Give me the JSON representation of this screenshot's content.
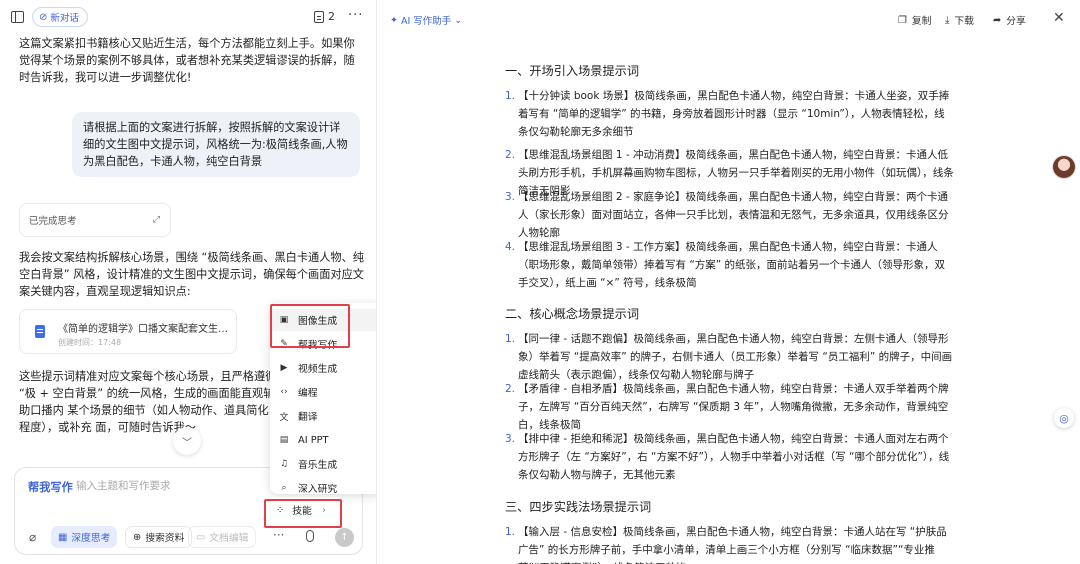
{
  "left_panel": {
    "new_chat_label": "新对话",
    "doc_count": "2",
    "messages": {
      "intro": "这篇文案紧扣书籍核心又贴近生活，每个方法都能立刻上手。如果你觉得某个场景的案例不够具体，或者想补充某类逻辑谬误的拆解，随时告诉我，我可以进一步调整优化!",
      "user_request": "请根据上面的文案进行拆解，按照拆解的文案设计详细的文生图中文提示词，风格统一为:极简线条画,人物为黑白配色，卡通人物，纯空白背景",
      "thinking_label": "已完成思考",
      "reply": "我会按文案结构拆解核心场景，围绕 “极简线条画、黑白卡通人物、纯空白背景” 风格，设计精准的文生图中文提示词，确保每个画面对应文案关键内容，直观呈现逻辑知识点:",
      "doc_card_title": "《简单的逻辑学》口播文案配套文生图提...",
      "doc_card_time": "创建时间：17:48",
      "tail": "这些提示词精准对应文案每个核心场景，且严格遵循 “极 + 空白背景” 的统一风格，生成的画面能直观辅助口播内 某个场景的细节（如人物动作、道具简化程度），或补充 面，可随时告诉我～"
    },
    "composer": {
      "mode_label": "帮我写作",
      "placeholder": "输入主题和写作要求",
      "chips": {
        "deep_think": "深度思考",
        "search": "搜索资料",
        "doc_edit": "文档编辑"
      }
    },
    "skills_menu": {
      "items": [
        {
          "icon": "image-gen-icon",
          "glyph": "▣",
          "label": "图像生成"
        },
        {
          "icon": "writing-icon",
          "glyph": "✎",
          "label": "帮我写作"
        },
        {
          "icon": "video-gen-icon",
          "glyph": "▶",
          "label": "视频生成"
        },
        {
          "icon": "code-icon",
          "glyph": "‹›",
          "label": "编程"
        },
        {
          "icon": "translate-icon",
          "glyph": "文",
          "label": "翻译"
        },
        {
          "icon": "ppt-icon",
          "glyph": "▤",
          "label": "AI PPT"
        },
        {
          "icon": "music-icon",
          "glyph": "♫",
          "label": "音乐生成"
        },
        {
          "icon": "research-icon",
          "glyph": "⌕",
          "label": "深入研究"
        }
      ],
      "skills_label": "技能"
    }
  },
  "right_panel": {
    "ai_writer_label": "AI 写作助手",
    "toolbar": {
      "copy": "复制",
      "download": "下载",
      "share": "分享"
    },
    "sections": [
      {
        "title": "一、开场引入场景提示词",
        "items": [
          "【十分钟读 book 场景】极简线条画，黑白配色卡通人物，纯空白背景：卡通人坐姿，双手捧着写有 “简单的逻辑学” 的书籍，身旁放着圆形计时器（显示 “10min”），人物表情轻松，线条仅勾勒轮廓无多余细节",
          "【思维混乱场景组图 1 - 冲动消费】极简线条画，黑白配色卡通人物，纯空白背景：卡通人低头刷方形手机，手机屏幕画购物车图标，人物另一只手举着刚买的无用小物件（如玩偶），线条简洁无阴影",
          "【思维混乱场景组图 2 - 家庭争论】极简线条画，黑白配色卡通人物，纯空白背景：两个卡通人（家长形象）面对面站立，各伸一只手比划，表情温和无怒气，无多余道具，仅用线条区分人物轮廓",
          "【思维混乱场景组图 3 - 工作方案】极简线条画，黑白配色卡通人物，纯空白背景：卡通人（职场形象，戴简单领带）捧着写有 “方案” 的纸张，面前站着另一个卡通人（领导形象，双手交叉），纸上画 “×” 符号，线条极简"
        ]
      },
      {
        "title": "二、核心概念场景提示词",
        "items": [
          "【同一律 - 话题不跑偏】极简线条画，黑白配色卡通人物，纯空白背景：左侧卡通人（领导形象）举着写 “提高效率” 的牌子，右侧卡通人（员工形象）举着写 “员工福利” 的牌子，中间画虚线箭头（表示跑偏），线条仅勾勒人物轮廓与牌子",
          "【矛盾律 - 自相矛盾】极简线条画，黑白配色卡通人物，纯空白背景：卡通人双手举着两个牌子，左牌写 “百分百纯天然”，右牌写 “保质期 3 年”，人物嘴角微撇，无多余动作，背景纯空白，线条极简",
          "【排中律 - 拒绝和稀泥】极简线条画，黑白配色卡通人物，纯空白背景：卡通人面对左右两个方形牌子（左 “方案好”，右 “方案不好”），人物手中举着小对话框（写 “哪个部分优化”），线条仅勾勒人物与牌子，无其他元素"
        ]
      },
      {
        "title": "三、四步实践法场景提示词",
        "items": [
          "【输入层 - 信息安检】极简线条画，黑白配色卡通人物，纯空白背景：卡通人站在写 “护肤品广告” 的长方形牌子前，手中拿小清单，清单上画三个小方框（分别写 “临床数据”“专业推荐”“无隐瞒案例”），线条简洁无装饰"
        ]
      }
    ],
    "colors": {
      "accent": "#3e64d9",
      "highlight": "#e53e4a"
    }
  }
}
